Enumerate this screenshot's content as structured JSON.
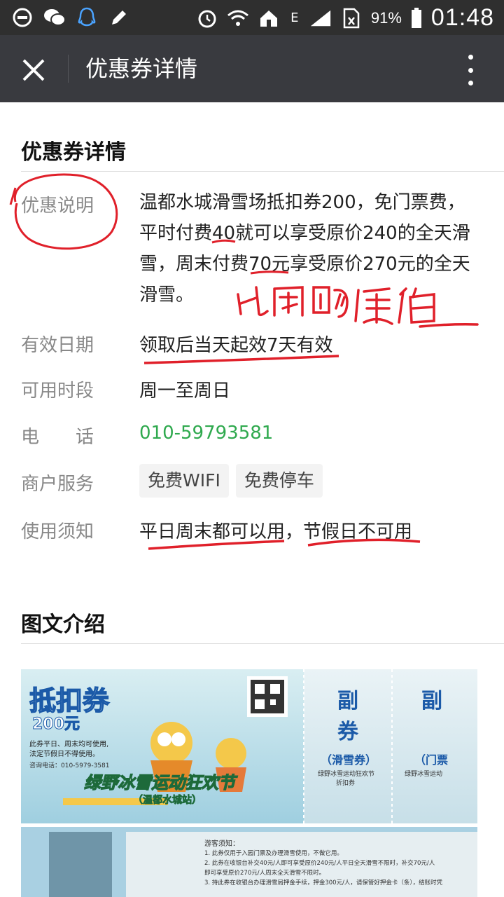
{
  "status_bar": {
    "signal_label": "E",
    "battery": "91%",
    "time": "01:48"
  },
  "header": {
    "title": "优惠券详情",
    "close_icon": "close-icon",
    "more_icon": "more-vertical-icon"
  },
  "details": {
    "section_title": "优惠券详情",
    "rows": [
      {
        "label": "优惠说明",
        "lines": [
          "温都水城滑雪场抵扣券200，免门票费，",
          "平时付费40就可以享受原价240的全天滑",
          "雪，周末付费70元享受原价270元的全天",
          "滑雪。"
        ]
      },
      {
        "label": "有效日期",
        "value": "领取后当天起效7天有效"
      },
      {
        "label": "可用时段",
        "value": "周一至周日"
      },
      {
        "label": "电　　话",
        "value": "010-59793581"
      },
      {
        "label": "商户服务",
        "tags": [
          "免费WIFI",
          "免费停车"
        ]
      },
      {
        "label": "使用须知",
        "value": "平日周末都可以用，节假日不可用"
      }
    ],
    "handwritten_note": "比团购便宜"
  },
  "intro": {
    "section_title": "图文介绍",
    "poster": {
      "title": "抵扣券",
      "amount": "200元",
      "note_1": "此券平日、周末均可使用,",
      "note_2": "法定节假日不得使用。",
      "phone": "咨询电话：010-5979-3581",
      "banner": "绿野冰雪运动狂欢节",
      "subbanner": "（温都水城站）",
      "stub_1_title": "副",
      "stub_1_title2": "券",
      "stub_1_sub": "（滑雪券）",
      "stub_1_caption_1": "绿野冰雪运动狂欢节",
      "stub_1_caption_2": "折扣券",
      "stub_2_title": "副",
      "stub_2_sub": "（门票",
      "stub_2_caption": "绿野冰雪运动",
      "rules_title": "游客须知：",
      "rules": [
        "1. 此券仅用于入园门票及办理滑雪使用，不做它用。",
        "2. 此券在收银台补交40元/人即可享受原价240元/人平日全天滑雪不限时，补交70元/人",
        "   即可享受原价270元/人周末全天滑雪不限时。",
        "3. 持此券在收银台办理滑雪局押金手续，押金300元/人，请保管好押金卡（条），结账时凭"
      ]
    }
  },
  "colors": {
    "title_bar": "#393a3f",
    "status_bar": "#2f2f2f",
    "phone_green": "#2fa94e",
    "annotation_red": "#e0202a"
  }
}
